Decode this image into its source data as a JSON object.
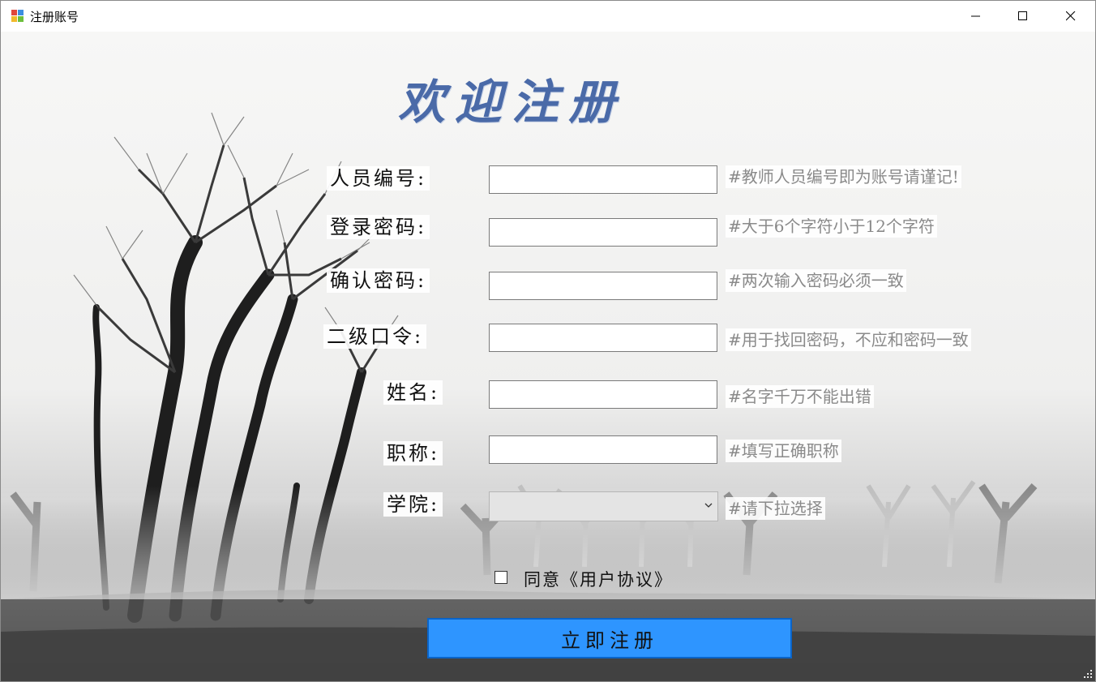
{
  "window": {
    "title": "注册账号",
    "icon": "app-icon",
    "controls": [
      "minimize-icon",
      "maximize-icon",
      "close-icon"
    ]
  },
  "heading": "欢迎注册",
  "form": {
    "fields": [
      {
        "label": "人员编号:",
        "value": "",
        "hint": "#教师人员编号即为账号请谨记!"
      },
      {
        "label": "登录密码:",
        "value": "",
        "hint": "#大于6个字符小于12个字符"
      },
      {
        "label": "确认密码:",
        "value": "",
        "hint": "#两次输入密码必须一致"
      },
      {
        "label": "二级口令:",
        "value": "",
        "hint": "#用于找回密码，不应和密码一致"
      },
      {
        "label": "姓名:",
        "value": "",
        "hint": "#名字千万不能出错"
      },
      {
        "label": "职称:",
        "value": "",
        "hint": "#填写正确职称"
      }
    ],
    "college": {
      "label": "学院:",
      "selected": "",
      "hint": "#请下拉选择"
    },
    "agree_label": "同意《用户协议》",
    "agree_checked": false,
    "submit_label": "立即注册"
  },
  "colors": {
    "heading": "#4a6aa8",
    "button_fill": "#2e95ff",
    "button_border": "#0a64c8",
    "hint_text": "#8a8a8a"
  }
}
